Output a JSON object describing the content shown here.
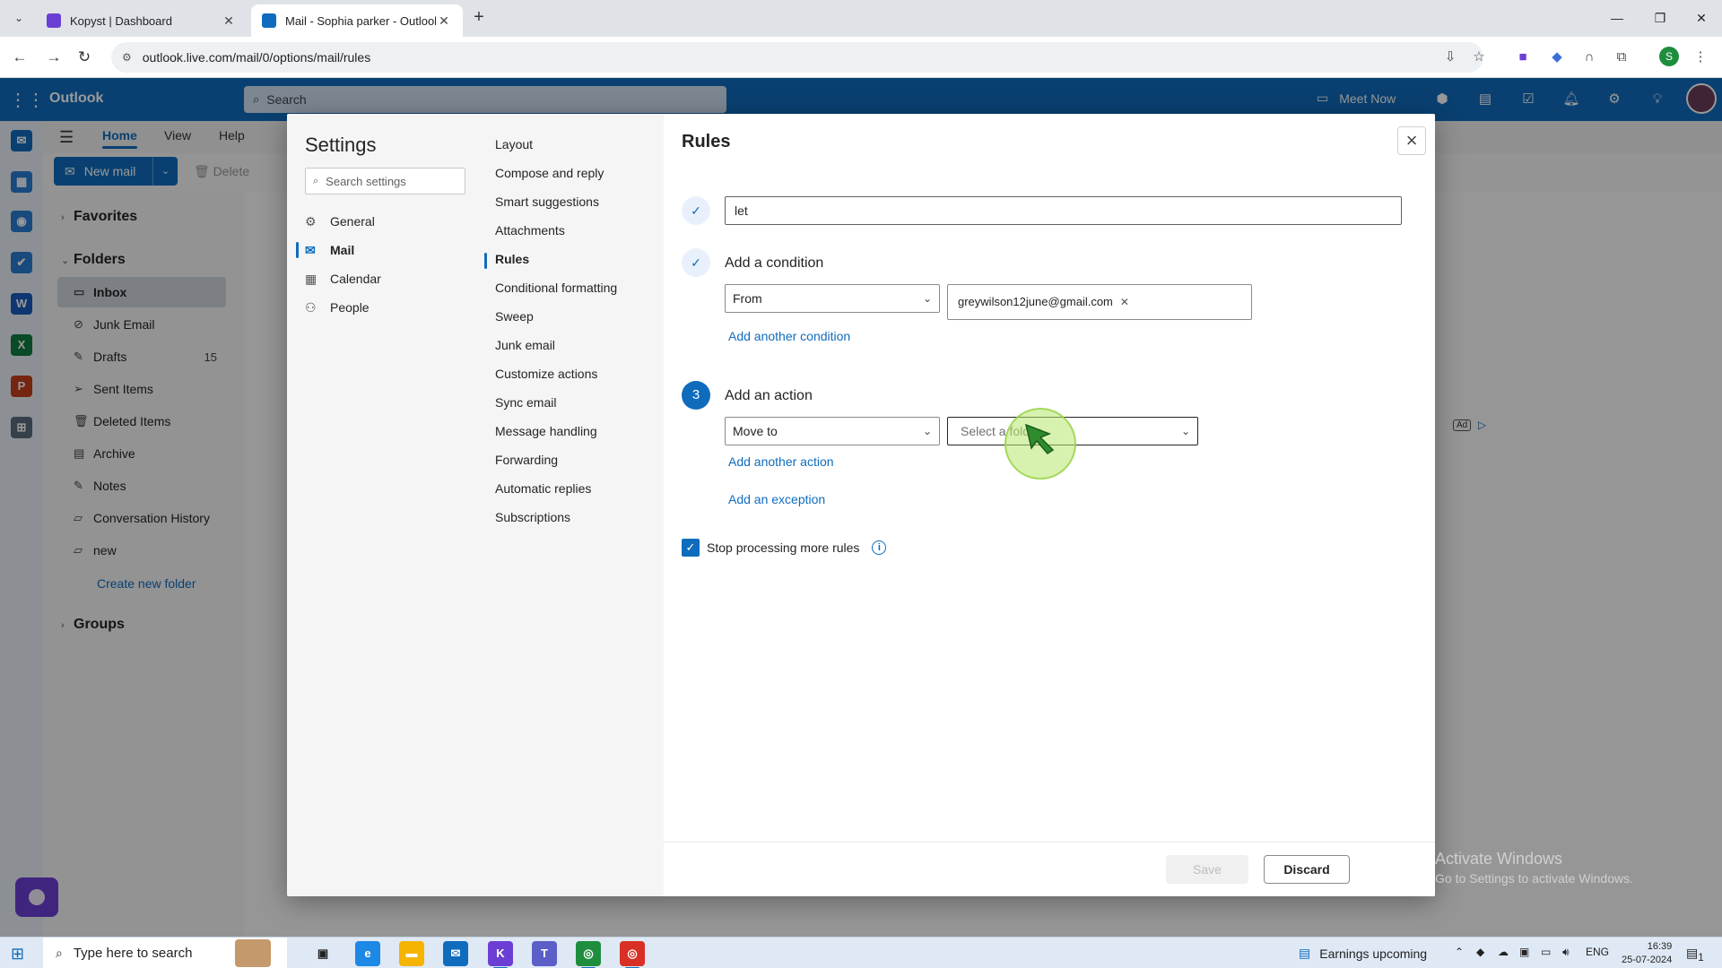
{
  "browser": {
    "tabs": [
      {
        "title": "Kopyst | Dashboard",
        "active": false
      },
      {
        "title": "Mail - Sophia parker - Outlook",
        "active": true
      }
    ],
    "url": "outlook.live.com/mail/0/options/mail/rules",
    "profile_initial": "S"
  },
  "outlook": {
    "brand": "Outlook",
    "search_placeholder": "Search",
    "meet_now": "Meet Now",
    "ribbon_tabs": [
      "Home",
      "View",
      "Help"
    ],
    "new_mail": "New mail",
    "delete": "Delete",
    "favorites": "Favorites",
    "folders_header": "Folders",
    "folders": [
      {
        "name": "Inbox",
        "count": "",
        "icon": "inbox-icon"
      },
      {
        "name": "Junk Email",
        "count": "",
        "icon": "junk-icon"
      },
      {
        "name": "Drafts",
        "count": "15",
        "icon": "draft-icon"
      },
      {
        "name": "Sent Items",
        "count": "",
        "icon": "send-icon"
      },
      {
        "name": "Deleted Items",
        "count": "",
        "icon": "trash-icon"
      },
      {
        "name": "Archive",
        "count": "",
        "icon": "archive-icon"
      },
      {
        "name": "Notes",
        "count": "",
        "icon": "note-icon"
      },
      {
        "name": "Conversation History",
        "count": "",
        "icon": "folder-icon"
      },
      {
        "name": "new",
        "count": "",
        "icon": "folder-icon"
      }
    ],
    "create_folder": "Create new folder",
    "groups": "Groups",
    "ad_label": "Ad"
  },
  "settings": {
    "title": "Settings",
    "search_placeholder": "Search settings",
    "categories": [
      {
        "label": "General",
        "icon": "gear-icon"
      },
      {
        "label": "Mail",
        "icon": "mail-icon"
      },
      {
        "label": "Calendar",
        "icon": "calendar-icon"
      },
      {
        "label": "People",
        "icon": "people-icon"
      }
    ],
    "selected_category": "Mail",
    "subcategories": [
      "Layout",
      "Compose and reply",
      "Smart suggestions",
      "Attachments",
      "Rules",
      "Conditional formatting",
      "Sweep",
      "Junk email",
      "Customize actions",
      "Sync email",
      "Message handling",
      "Forwarding",
      "Automatic replies",
      "Subscriptions"
    ],
    "selected_subcategory": "Rules"
  },
  "rules": {
    "title": "Rules",
    "rule_name": "let",
    "condition_label": "Add a condition",
    "condition_type": "From",
    "condition_value": "greywilson12june@gmail.com",
    "add_condition": "Add another condition",
    "action_step": "3",
    "action_label": "Add an action",
    "action_type": "Move to",
    "folder_placeholder": "Select a folder",
    "add_action": "Add another action",
    "add_exception": "Add an exception",
    "stop_processing": "Stop processing more rules",
    "stop_processing_checked": true,
    "save": "Save",
    "discard": "Discard"
  },
  "watermark": {
    "line1": "Activate Windows",
    "line2": "Go to Settings to activate Windows."
  },
  "taskbar": {
    "search_placeholder": "Type here to search",
    "earnings": "Earnings upcoming",
    "language": "ENG",
    "time": "16:39",
    "date": "25-07-2024",
    "notification_count": "1"
  }
}
